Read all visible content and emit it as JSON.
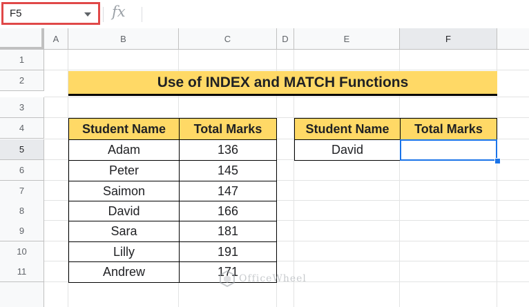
{
  "formula_bar": {
    "name_box": "F5",
    "fx_label": "fx",
    "formula": ""
  },
  "columns": [
    "A",
    "B",
    "C",
    "D",
    "E",
    "F"
  ],
  "rows": [
    "1",
    "2",
    "3",
    "4",
    "5",
    "6",
    "7",
    "8",
    "9",
    "10",
    "11"
  ],
  "sheet": {
    "title": "Use of INDEX and MATCH Functions",
    "table1": {
      "headers": [
        "Student Name",
        "Total Marks"
      ],
      "rows": [
        [
          "Adam",
          "136"
        ],
        [
          "Peter",
          "145"
        ],
        [
          "Saimon",
          "147"
        ],
        [
          "David",
          "166"
        ],
        [
          "Sara",
          "181"
        ],
        [
          "Lilly",
          "191"
        ],
        [
          "Andrew",
          "171"
        ]
      ]
    },
    "table2": {
      "headers": [
        "Student Name",
        "Total Marks"
      ],
      "row": [
        "David",
        ""
      ]
    }
  },
  "selection": {
    "active_cell": "F5",
    "active_column": "F",
    "active_row": "5"
  },
  "watermark": "OfficeWheel",
  "colors": {
    "header_fill": "#ffd966",
    "selection": "#1a73e8",
    "namebox_highlight": "#e04848"
  }
}
